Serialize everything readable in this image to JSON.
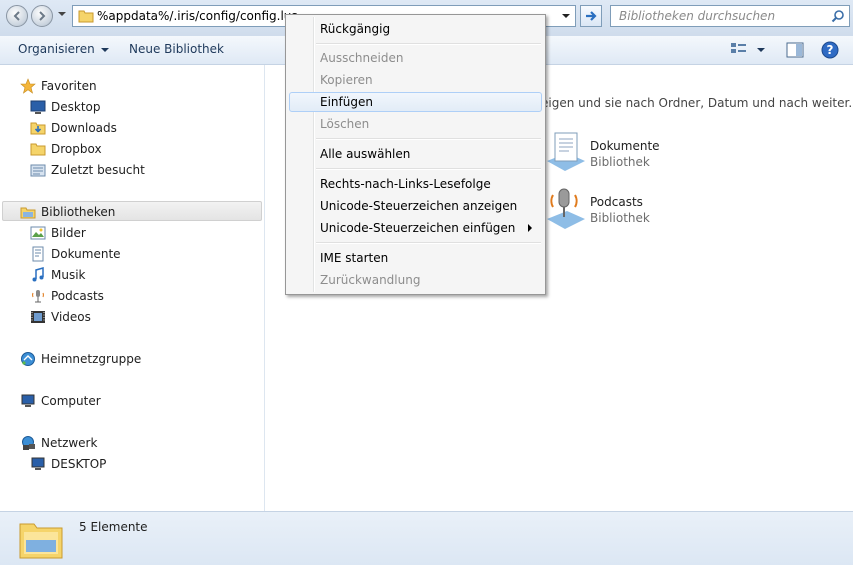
{
  "address": {
    "path": "%appdata%/.iris/config/config.lua"
  },
  "search": {
    "placeholder": "Bibliotheken durchsuchen"
  },
  "toolbar": {
    "organize_label": "Organisieren",
    "new_library_label": "Neue Bibliothek"
  },
  "sidebar": {
    "favorites_label": "Favoriten",
    "favorites": [
      "Desktop",
      "Downloads",
      "Dropbox",
      "Zuletzt besucht"
    ],
    "libraries_label": "Bibliotheken",
    "libraries": [
      "Bilder",
      "Dokumente",
      "Musik",
      "Podcasts",
      "Videos"
    ],
    "homegroup_label": "Heimnetzgruppe",
    "computer_label": "Computer",
    "network_label": "Netzwerk",
    "network_items": [
      "DESKTOP"
    ]
  },
  "content": {
    "hint": "eigen und sie nach Ordner, Datum und nach weiter...",
    "libraries": [
      {
        "name": "Dokumente",
        "type": "Bibliothek"
      },
      {
        "name": "Podcasts",
        "type": "Bibliothek"
      }
    ]
  },
  "context_menu": {
    "items": [
      {
        "label": "Rückgängig",
        "enabled": true
      },
      {
        "label": "Ausschneiden",
        "enabled": false
      },
      {
        "label": "Kopieren",
        "enabled": false
      },
      {
        "label": "Einfügen",
        "enabled": true,
        "highlighted": true
      },
      {
        "label": "Löschen",
        "enabled": false
      },
      {
        "label": "Alle auswählen",
        "enabled": true
      },
      {
        "label": "Rechts-nach-Links-Lesefolge",
        "enabled": true
      },
      {
        "label": "Unicode-Steuerzeichen anzeigen",
        "enabled": true
      },
      {
        "label": "Unicode-Steuerzeichen einfügen",
        "enabled": true,
        "has_submenu": true
      },
      {
        "label": "IME starten",
        "enabled": true
      },
      {
        "label": "Zurückwandlung",
        "enabled": false
      }
    ]
  },
  "status": {
    "count": "5 Elemente"
  },
  "colors": {
    "accent": "#1e395b",
    "hover_border": "#aecff7",
    "disabled_text": "#8d8d8d"
  }
}
